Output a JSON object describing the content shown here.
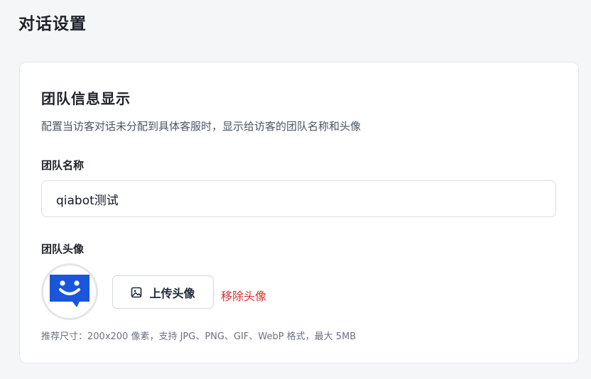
{
  "page": {
    "title": "对话设置"
  },
  "team_card": {
    "title": "团队信息显示",
    "description": "配置当访客对话未分配到具体客服时，显示给访客的团队名称和头像",
    "name_field": {
      "label": "团队名称",
      "value": "qiabot测试"
    },
    "avatar_field": {
      "label": "团队头像",
      "upload_label": "上传头像",
      "upload_icon": "image-icon",
      "remove_label": "移除头像",
      "hint": "推荐尺寸：200x200 像素，支持 JPG、PNG、GIF、WebP 格式，最大 5MB",
      "avatar_icon": "chat-bot-icon",
      "avatar_color": "#1a56db"
    }
  },
  "colors": {
    "accent_blue": "#1a56db",
    "danger": "#d9302c"
  }
}
